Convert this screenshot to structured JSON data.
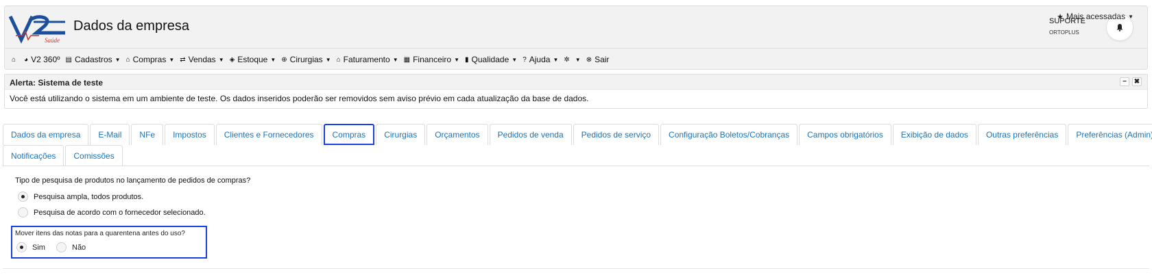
{
  "header": {
    "title": "Dados da empresa",
    "user_name": "SUPORTE",
    "user_org": "ORTOPLUS",
    "logo_text": "V2 Saúde"
  },
  "menu": {
    "items": [
      {
        "label": "",
        "icon": "home-icon",
        "glyph": "⌂",
        "caret": false
      },
      {
        "label": "V2 360º",
        "icon": "pie-chart-icon",
        "glyph": "◕",
        "caret": false
      },
      {
        "label": "Cadastros",
        "icon": "file-icon",
        "glyph": "▤",
        "caret": true
      },
      {
        "label": "Compras",
        "icon": "shopping-bag-icon",
        "glyph": "⌂",
        "caret": true
      },
      {
        "label": "Vendas",
        "icon": "exchange-icon",
        "glyph": "⇄",
        "caret": true
      },
      {
        "label": "Estoque",
        "icon": "tag-icon",
        "glyph": "◈",
        "caret": true
      },
      {
        "label": "Cirurgias",
        "icon": "plus-circle-icon",
        "glyph": "⊕",
        "caret": true
      },
      {
        "label": "Faturamento",
        "icon": "bank-icon",
        "glyph": "⌂",
        "caret": true
      },
      {
        "label": "Financeiro",
        "icon": "money-icon",
        "glyph": "▦",
        "caret": true
      },
      {
        "label": "Qualidade",
        "icon": "book-icon",
        "glyph": "▮",
        "caret": true
      },
      {
        "label": "Ajuda",
        "icon": "question-icon",
        "glyph": "?",
        "caret": true
      },
      {
        "label": "",
        "icon": "gear-icon",
        "glyph": "✲",
        "caret": true
      },
      {
        "label": "Sair",
        "icon": "close-circle-icon",
        "glyph": "⊗",
        "caret": false
      }
    ],
    "right": {
      "label": "Mais acessadas",
      "icon": "star-icon",
      "glyph": "★"
    }
  },
  "alert": {
    "title": "Alerta: Sistema de teste",
    "message": "Você está utilizando o sistema em um ambiente de teste. Os dados inseridos poderão ser removidos sem aviso prévio em cada atualização da base de dados."
  },
  "tabs": {
    "row1": [
      "Dados da empresa",
      "E-Mail",
      "NFe",
      "Impostos",
      "Clientes e Fornecedores",
      "Compras",
      "Cirurgias",
      "Orçamentos",
      "Pedidos de venda",
      "Pedidos de serviço",
      "Configuração Boletos/Cobranças",
      "Campos obrigatórios",
      "Exibição de dados",
      "Outras preferências",
      "Preferências (Admin)"
    ],
    "row2": [
      "Notificações",
      "Comissões"
    ],
    "active": "Compras"
  },
  "form": {
    "q1": "Tipo de pesquisa de produtos no lançamento de pedidos de compras?",
    "q1_options": [
      {
        "label": "Pesquisa ampla, todos produtos.",
        "checked": true
      },
      {
        "label": "Pesquisa de acordo com o fornecedor selecionado.",
        "checked": false
      }
    ],
    "q2": "Mover itens das notas para a quarentena antes do uso?",
    "q2_options": [
      {
        "label": "Sim",
        "checked": true
      },
      {
        "label": "Não",
        "checked": false
      }
    ]
  },
  "colors": {
    "accent": "#1a73b8",
    "highlight": "#1a3fe0"
  }
}
